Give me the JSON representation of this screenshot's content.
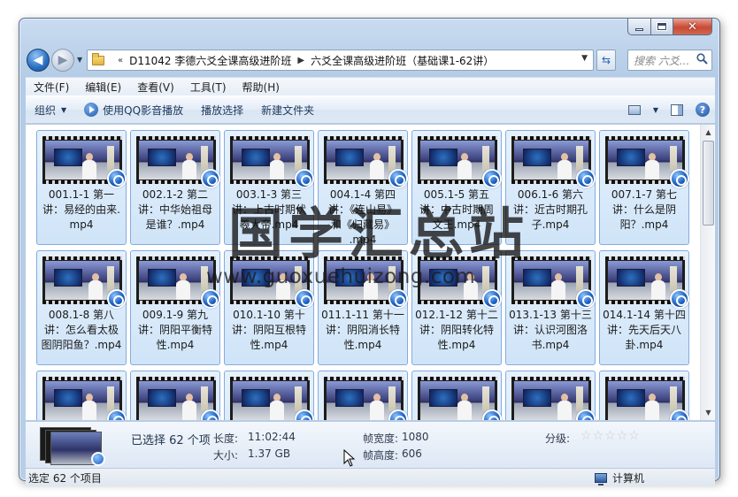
{
  "window": {
    "breadcrumbs": [
      "D11042 李德六爻全课高级进阶班",
      "六爻全课高级进阶班（基础课1-62讲）"
    ],
    "search_placeholder": "搜索 六爻..."
  },
  "menu": [
    "文件(F)",
    "编辑(E)",
    "查看(V)",
    "工具(T)",
    "帮助(H)"
  ],
  "toolbar": {
    "organize": "组织",
    "play_qq": "使用QQ影音播放",
    "play_selection": "播放选择",
    "new_folder": "新建文件夹"
  },
  "files": [
    [
      "001.1-1 第一",
      "讲：易经的由来.",
      "mp4"
    ],
    [
      "002.1-2 第二",
      "讲：中华始祖母",
      "是谁？.mp4"
    ],
    [
      "003.1-3 第三",
      "讲：上古时期伏",
      "羲大帝.mp4"
    ],
    [
      "004.1-4 第四",
      "讲：《连山易》",
      "和《归藏易》",
      ".mp4"
    ],
    [
      "005.1-5 第五",
      "讲：中古时期周",
      "文王.mp4"
    ],
    [
      "006.1-6 第六",
      "讲：近古时期孔",
      "子.mp4"
    ],
    [
      "007.1-7 第七",
      "讲：什么是阴",
      "阳？.mp4"
    ],
    [
      "008.1-8 第八",
      "讲：怎么看太极",
      "图阴阳鱼？.mp4"
    ],
    [
      "009.1-9 第九",
      "讲：阴阳平衡特",
      "性.mp4"
    ],
    [
      "010.1-10 第十",
      "讲：阴阳互根特",
      "性.mp4"
    ],
    [
      "011.1-11 第十一",
      "讲：阴阳消长特",
      "性.mp4"
    ],
    [
      "012.1-12 第十二",
      "讲：阴阳转化特",
      "性.mp4"
    ],
    [
      "013.1-13 第十三",
      "讲：认识河图洛",
      "书.mp4"
    ],
    [
      "014.1-14 第十四",
      "讲：先天后天八",
      "卦.mp4"
    ],
    [],
    [],
    [],
    [],
    [],
    [],
    []
  ],
  "details": {
    "selected": "已选择 62 个项",
    "length_label": "长度:",
    "length": "11:02:44",
    "size_label": "大小:",
    "size": "1.37 GB",
    "frame_width_label": "帧宽度:",
    "frame_width": "1080",
    "frame_height_label": "帧高度:",
    "frame_height": "606",
    "rating_label": "分级:",
    "rating": 0
  },
  "status": {
    "left": "选定 62 个项目",
    "right": "计算机"
  },
  "watermark": {
    "main": "国学汇总站",
    "url": "www.guoxuehuizong.com"
  }
}
